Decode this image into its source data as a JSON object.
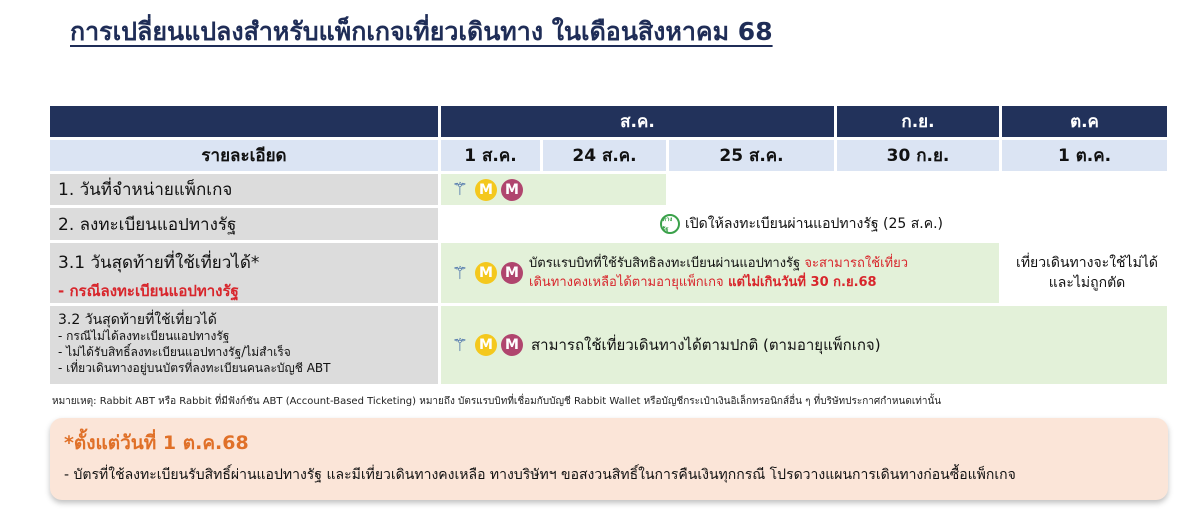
{
  "title": "การเปลี่ยนแปลงสำหรับแพ็กเกจเที่ยวเดินทาง ในเดือนสิงหาคม 68",
  "table": {
    "month_headers": [
      "ส.ค.",
      "ก.ย.",
      "ต.ค"
    ],
    "detail_header": "รายละเอียด",
    "date_headers": [
      "1 ส.ค.",
      "24 ส.ค.",
      "25 ส.ค.",
      "30 ก.ย.",
      "1 ต.ค."
    ],
    "rows": {
      "r1": {
        "label": "1.   วันที่จำหน่ายแพ็กเกจ"
      },
      "r2": {
        "label": "2. ลงทะเบียนแอปทางรัฐ",
        "app_icon_text": "ทางรัฐ",
        "text": "เปิดให้ลงทะเบียนผ่านแอปทางรัฐ (25 ส.ค.)"
      },
      "r3": {
        "label": "3.1 วันสุดท้ายที่ใช้เที่ยวได้*",
        "sublabel": "- กรณีลงทะเบียนแอปทางรัฐ",
        "text_plain": "บัตรแรบบิทที่ใช้รับสิทธิลงทะเบียนผ่านแอปทางรัฐ ",
        "text_red1": "จะสามารถใช้เที่ยว",
        "text_red2": "เดินทางคงเหลือได้ตามอายุแพ็กเกจ",
        "text_bold": " แต่ไม่เกินวันที่ 30 ก.ย.68",
        "oct_text_line1": "เที่ยวเดินทางจะใช้ไม่ได้",
        "oct_text_line2": "และไม่ถูกตัด"
      },
      "r4": {
        "label": "3.2 วันสุดท้ายที่ใช้เที่ยวได้",
        "bullets": [
          "- กรณีไม่ได้ลงทะเบียนแอปทางรัฐ",
          "- ไม่ได้รับสิทธิ์ลงทะเบียนแอปทางรัฐ/ไม่สำเร็จ",
          "- เที่ยวเดินทางอยู่บนบัตรที่ลงทะเบียนคนละบัญชี ABT"
        ],
        "text": "สามารถใช้เที่ยวเดินทางได้ตามปกติ (ตามอายุแพ็กเกจ)"
      }
    },
    "logos": {
      "bts": "BTS",
      "m": "M"
    }
  },
  "footnote": "หมายเหตุ: Rabbit ABT หรือ Rabbit ที่มีฟังก์ชัน ABT (Account-Based Ticketing) หมายถึง บัตรแรบบิทที่เชื่อมกับบัญชี Rabbit Wallet หรือบัญชีกระเป๋าเงินอิเล็กทรอนิกส์อื่น ๆ ที่บริษัทประกาศกำหนดเท่านั้น",
  "notice": {
    "title": "*ตั้งแต่วันที่ 1 ต.ค.68",
    "body": "- บัตรที่ใช้ลงทะเบียนรับสิทธิ์ผ่านแอปทางรัฐ และมีเที่ยวเดินทางคงเหลือ ทางบริษัทฯ ขอสงวนสิทธิ์ในการคืนเงินทุกกรณี โปรดวางแผนการเดินทางก่อนซื้อแพ็กเกจ"
  },
  "colors": {
    "navy": "#22325b",
    "light_blue": "#dbe4f3",
    "green": "#e3f1d9",
    "red": "#d8262c",
    "orange": "#e07028",
    "notice_bg": "#fbe5d8"
  }
}
